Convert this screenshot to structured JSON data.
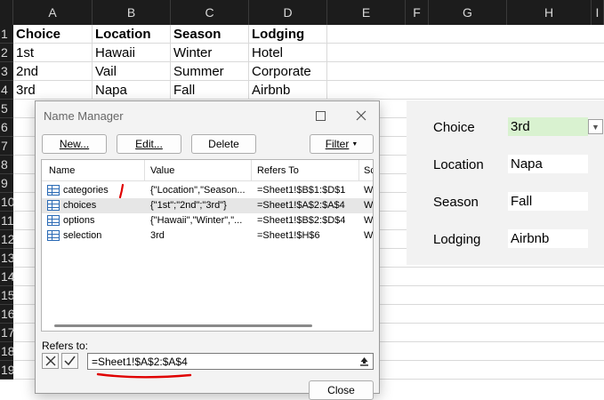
{
  "columns": [
    "A",
    "B",
    "C",
    "D",
    "E",
    "F",
    "G",
    "H",
    "I"
  ],
  "rows": [
    "1",
    "2",
    "3",
    "4",
    "5",
    "6",
    "7",
    "8",
    "9",
    "10",
    "11",
    "12",
    "13",
    "14",
    "15",
    "16",
    "17",
    "18",
    "19"
  ],
  "sheet": {
    "header": [
      "Choice",
      "Location",
      "Season",
      "Lodging"
    ],
    "data": [
      [
        "1st",
        "Hawaii",
        "Winter",
        "Hotel"
      ],
      [
        "2nd",
        "Vail",
        "Summer",
        "Corporate"
      ],
      [
        "3rd",
        "Napa",
        "Fall",
        "Airbnb"
      ]
    ]
  },
  "panel": {
    "choice_label": "Choice",
    "choice_value": "3rd",
    "location_label": "Location",
    "location_value": "Napa",
    "season_label": "Season",
    "season_value": "Fall",
    "lodging_label": "Lodging",
    "lodging_value": "Airbnb"
  },
  "dialog": {
    "title": "Name Manager",
    "buttons": {
      "new": "New...",
      "edit": "Edit...",
      "delete": "Delete",
      "filter": "Filter"
    },
    "columns": {
      "name": "Name",
      "value": "Value",
      "refers_to": "Refers To",
      "scope": "Sc"
    },
    "names": [
      {
        "name": "categories",
        "value": "{\"Location\",\"Season...",
        "refers_to": "=Sheet1!$B$1:$D$1",
        "scope": "W"
      },
      {
        "name": "choices",
        "value": "{\"1st\";\"2nd\";\"3rd\"}",
        "refers_to": "=Sheet1!$A$2:$A$4",
        "scope": "W"
      },
      {
        "name": "options",
        "value": "{\"Hawaii\",\"Winter\",\"...",
        "refers_to": "=Sheet1!$B$2:$D$4",
        "scope": "W"
      },
      {
        "name": "selection",
        "value": "3rd",
        "refers_to": "=Sheet1!$H$6",
        "scope": "W"
      }
    ],
    "refers_to_label": "Refers to:",
    "refers_to_value": "=Sheet1!$A$2:$A$4",
    "close_label": "Close"
  },
  "colors": {
    "accent_green": "#d9f2d0",
    "annotation_red": "#e00000",
    "icon_blue": "#2a6ab5"
  }
}
